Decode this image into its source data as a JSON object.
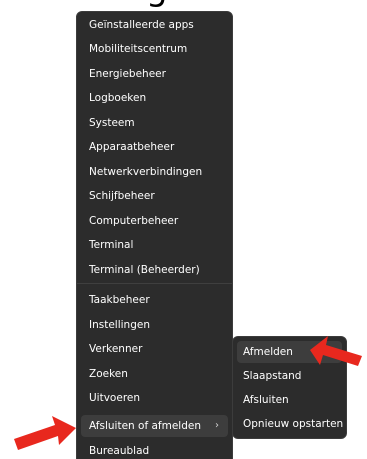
{
  "top_partial_text": "g",
  "menu": {
    "items": [
      {
        "label": "Geïnstalleerde apps"
      },
      {
        "label": "Mobiliteitscentrum"
      },
      {
        "label": "Energiebeheer"
      },
      {
        "label": "Logboeken"
      },
      {
        "label": "Systeem"
      },
      {
        "label": "Apparaatbeheer"
      },
      {
        "label": "Netwerkverbindingen"
      },
      {
        "label": "Schijfbeheer"
      },
      {
        "label": "Computerbeheer"
      },
      {
        "label": "Terminal"
      },
      {
        "label": "Terminal (Beheerder)"
      },
      {
        "label": "Taakbeheer"
      },
      {
        "label": "Instellingen"
      },
      {
        "label": "Verkenner"
      },
      {
        "label": "Zoeken"
      },
      {
        "label": "Uitvoeren"
      },
      {
        "label": "Afsluiten of afmelden",
        "chevron": "›"
      },
      {
        "label": "Bureaublad"
      }
    ]
  },
  "submenu": {
    "items": [
      {
        "label": "Afmelden"
      },
      {
        "label": "Slaapstand"
      },
      {
        "label": "Afsluiten"
      },
      {
        "label": "Opnieuw opstarten"
      }
    ]
  },
  "colors": {
    "menu_background": "#2c2c2c",
    "hover_background": "#3d3d3d",
    "text": "#ffffff",
    "arrow": "#e8281e"
  },
  "icons": {
    "submenu_chevron": "chevron-right-icon",
    "annotation_arrows": "red-arrow-icon"
  }
}
